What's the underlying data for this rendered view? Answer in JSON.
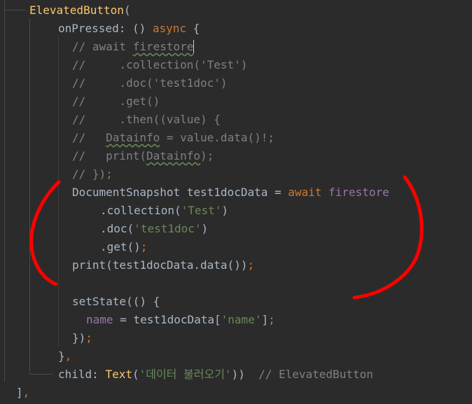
{
  "code": {
    "l1": {
      "name": "ElevatedButton",
      "punct": "("
    },
    "l2": {
      "prop": "onPressed",
      "mid": ": () ",
      "kw": "async",
      "end": " {"
    },
    "l3": {
      "a": "// await ",
      "b": "firestore"
    },
    "l4": "//     .collection('Test')",
    "l5": "//     .doc('test1doc')",
    "l6": "//     .get()",
    "l7": "//     .then((value) {",
    "l8": {
      "a": "//   ",
      "b": "Datainfo",
      "c": " = value.data()!;"
    },
    "l9": {
      "a": "//   print(",
      "b": "Datainfo",
      "c": ");"
    },
    "l10": "// });",
    "l11": {
      "a": "DocumentSnapshot test1docData = ",
      "kw1": "await",
      "sp": " ",
      "kw2": "firestore"
    },
    "l12": {
      "a": ".collection(",
      "s": "'Test'",
      "c": ")"
    },
    "l13": {
      "a": ".doc(",
      "s": "'test1doc'",
      "c": ")"
    },
    "l14": {
      "a": ".get()",
      "semi": ";"
    },
    "l15": {
      "a": "print(test1docData.data())",
      "semi": ";"
    },
    "l17": "setState(() {",
    "l18": {
      "prop": "name",
      "a": " = test1docData[",
      "s": "'name'",
      "c": "]",
      "semi": ";"
    },
    "l19": {
      "a": "})",
      "semi": ";"
    },
    "l20": {
      "a": "}",
      "comma": ","
    },
    "l21": {
      "child": "child: ",
      "cls": "Text",
      "a": "(",
      "s": "'데이터 불러오기'",
      "c": "))  ",
      "cm": "// ElevatedButton"
    },
    "l22": {
      "a": "]",
      "comma": ","
    }
  },
  "colors": {
    "background": "#2b2b2b",
    "default": "#a9b7c6",
    "keyword": "#cc7832",
    "class": "#ffc66d",
    "string": "#6a8759",
    "property": "#9876aa",
    "comment": "#808080",
    "annotation": "#ff0000"
  }
}
